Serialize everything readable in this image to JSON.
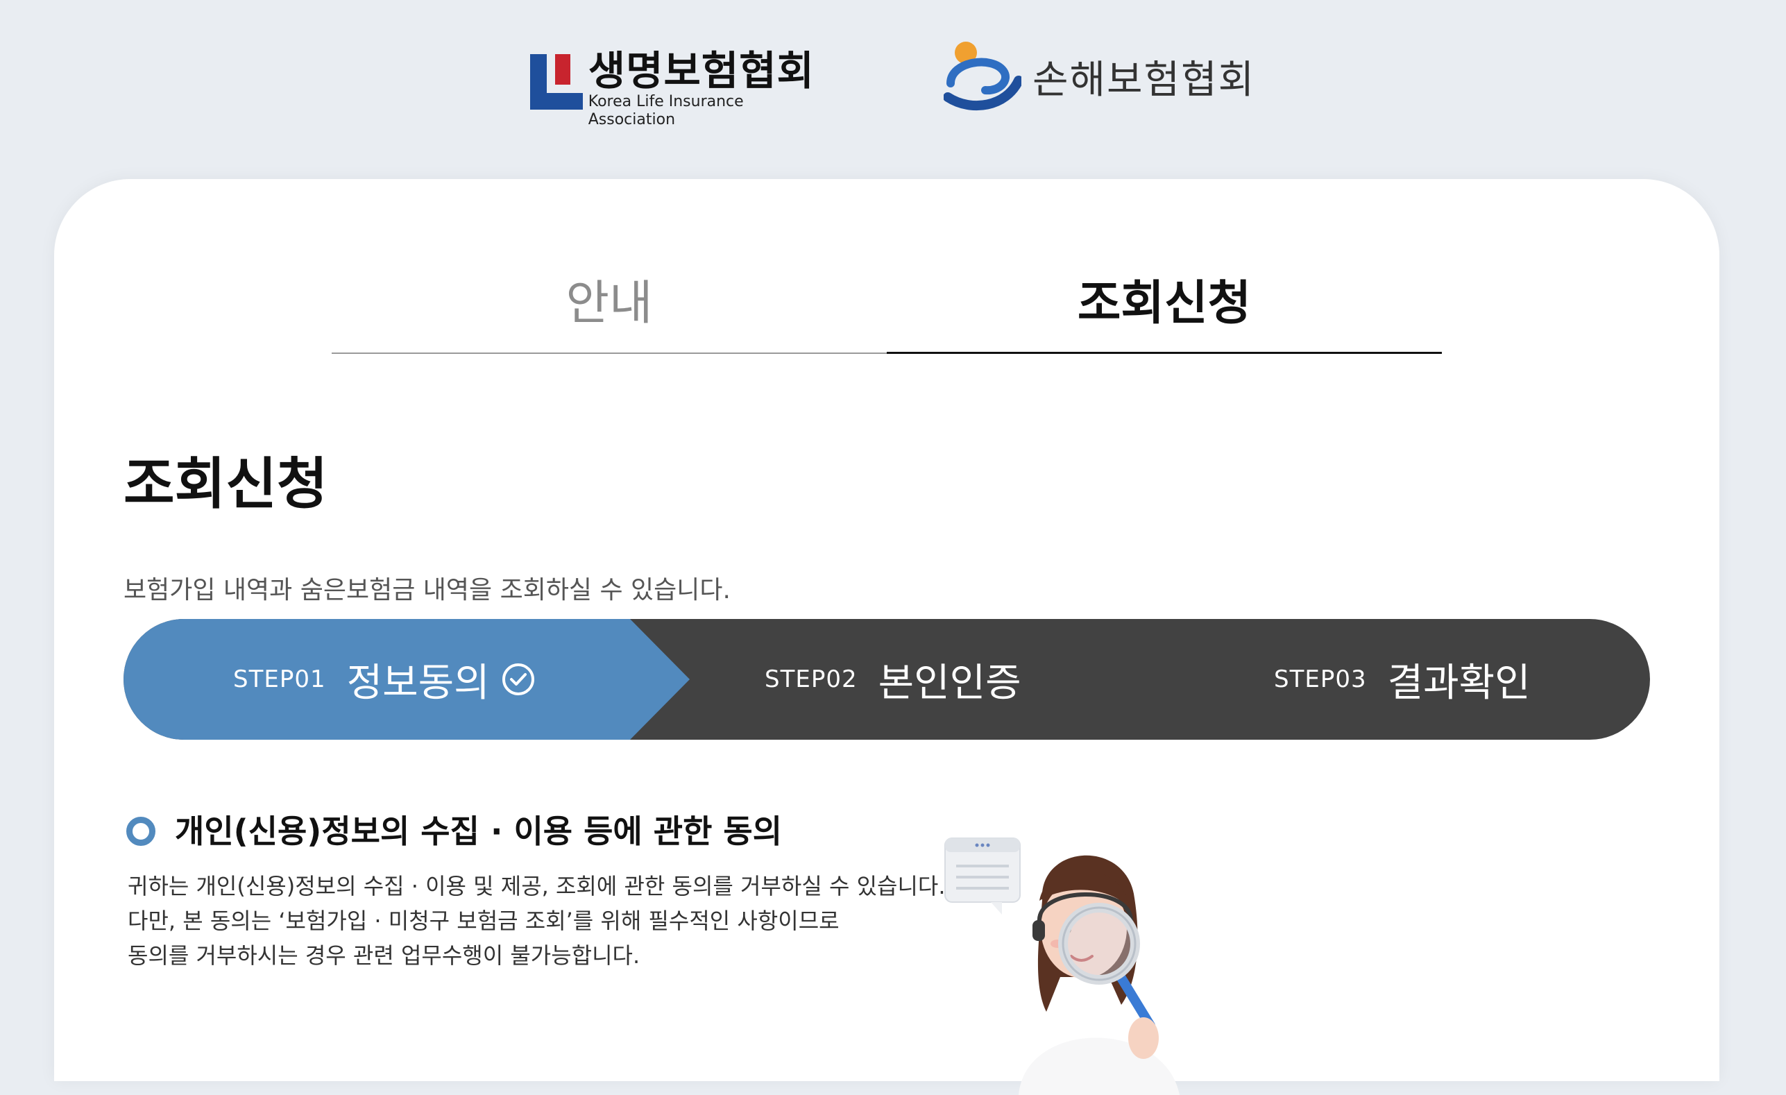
{
  "header": {
    "life_logo_ko": "생명보험협회",
    "life_logo_en": "Korea Life Insurance Association",
    "general_logo_ko": "손해보험협회"
  },
  "tabs": [
    {
      "label": "안내",
      "active": false
    },
    {
      "label": "조회신청",
      "active": true
    }
  ],
  "main": {
    "title": "조회신청",
    "description": "보험가입 내역과 숨은보험금 내역을 조회하실 수 있습니다."
  },
  "steps": [
    {
      "label": "STEP01",
      "name": "정보동의",
      "active": true
    },
    {
      "label": "STEP02",
      "name": "본인인증",
      "active": false
    },
    {
      "label": "STEP03",
      "name": "결과확인",
      "active": false
    }
  ],
  "consent": {
    "title": "개인(신용)정보의 수집 · 이용 등에 관한 동의",
    "lines": [
      "귀하는 개인(신용)정보의 수집 · 이용 및 제공, 조회에 관한 동의를 거부하실 수 있습니다.",
      "다만, 본 동의는 ‘보험가입 · 미청구 보험금 조회’를 위해 필수적인 사항이므로",
      "동의를 거부하시는 경우 관련 업무수행이 불가능합니다."
    ]
  },
  "colors": {
    "accent": "#528abe",
    "step_dark": "#424242",
    "background": "#e9edf2",
    "life_logo_blue": "#1f4f9c",
    "life_logo_red": "#c8242e"
  },
  "icons": {
    "step_complete": "check-circle-icon",
    "section_bullet": "radio-bullet-icon"
  }
}
